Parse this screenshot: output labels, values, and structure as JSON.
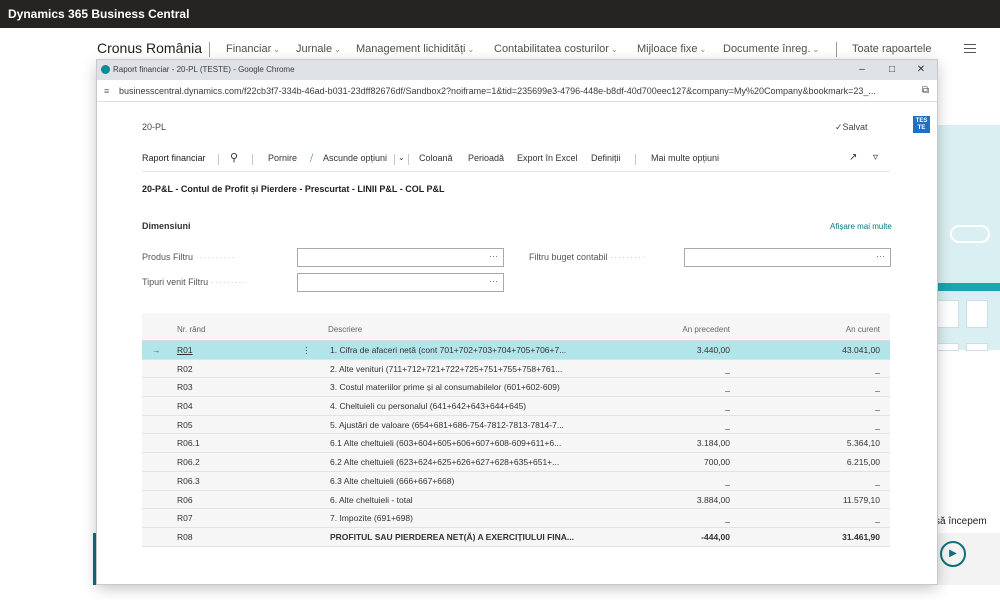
{
  "appbar": {
    "title": "Dynamics 365 Business Central"
  },
  "nav": {
    "company": "Cronus România",
    "items": [
      {
        "label": "Financiar",
        "chevron": true
      },
      {
        "label": "Jurnale",
        "chevron": true
      },
      {
        "label": "Management lichidități",
        "chevron": true
      },
      {
        "label": "Contabilitatea costurilor",
        "chevron": true
      },
      {
        "label": "Mijloace fixe",
        "chevron": true
      },
      {
        "label": "Documente înreg.",
        "chevron": true
      },
      {
        "label": "Toate rapoartele",
        "chevron": false
      }
    ]
  },
  "background": {
    "start_text": "să începem"
  },
  "browser": {
    "title": "Raport financiar - 20-PL (TESTE) - Google Chrome",
    "url": "businesscentral.dynamics.com/f22cb3f7-334b-46ad-b031-23dff82676df/Sandbox2?noiframe=1&tid=235699e3-4796-448e-b8df-40d700eec127&company=My%20Company&bookmark=23_..."
  },
  "page": {
    "record_id": "20-PL",
    "status": "Salvat",
    "test_badge": "TES TE",
    "report_title": "20-P&L - Contul de Profit și Pierdere - Prescurtat - LINII P&L - COL P&L"
  },
  "actions": {
    "main": "Raport financiar",
    "items": [
      "Pornire",
      "Ascunde opțiuni",
      "Coloană",
      "Perioadă",
      "Export în Excel",
      "Definiții",
      "Mai multe opțiuni"
    ]
  },
  "dimensions": {
    "title": "Dimensiuni",
    "show_more": "Afișare mai multe",
    "filters": [
      {
        "label": "Produs Filtru",
        "value": ""
      },
      {
        "label": "Tipuri venit Filtru",
        "value": ""
      },
      {
        "label": "Filtru buget contabil",
        "value": ""
      }
    ]
  },
  "table": {
    "headers": {
      "nr": "Nr. rând",
      "desc": "Descriere",
      "prev": "An precedent",
      "cur": "An curent"
    },
    "rows": [
      {
        "nr": "R01",
        "desc": "1. Cifra de afaceri netă (cont 701+702+703+704+705+706+7...",
        "prev": "3.440,00",
        "cur": "43.041,00",
        "selected": true,
        "bold": false
      },
      {
        "nr": "R02",
        "desc": "2. Alte venituri (711+712+721+722+725+751+755+758+761...",
        "prev": "_",
        "cur": "_",
        "selected": false,
        "bold": false
      },
      {
        "nr": "R03",
        "desc": "3. Costul materiilor prime și al consumabilelor (601+602-609)",
        "prev": "_",
        "cur": "_",
        "selected": false,
        "bold": false
      },
      {
        "nr": "R04",
        "desc": "4. Cheltuieli cu personalul (641+642+643+644+645)",
        "prev": "_",
        "cur": "_",
        "selected": false,
        "bold": false
      },
      {
        "nr": "R05",
        "desc": "5. Ajustări de valoare (654+681+686-754-7812-7813-7814-7...",
        "prev": "_",
        "cur": "_",
        "selected": false,
        "bold": false
      },
      {
        "nr": "R06.1",
        "desc": "6.1 Alte cheltuieli (603+604+605+606+607+608-609+611+6...",
        "prev": "3.184,00",
        "cur": "5.364,10",
        "selected": false,
        "bold": false
      },
      {
        "nr": "R06.2",
        "desc": "6.2 Alte cheltuieli (623+624+625+626+627+628+635+651+...",
        "prev": "700,00",
        "cur": "6.215,00",
        "selected": false,
        "bold": false
      },
      {
        "nr": "R06.3",
        "desc": "6.3 Alte cheltuieli (666+667+668)",
        "prev": "_",
        "cur": "_",
        "selected": false,
        "bold": false
      },
      {
        "nr": "R06",
        "desc": "6. Alte cheltuieli - total",
        "prev": "3.884,00",
        "cur": "11.579,10",
        "selected": false,
        "bold": false
      },
      {
        "nr": "R07",
        "desc": "7. Impozite (691+698)",
        "prev": "_",
        "cur": "_",
        "selected": false,
        "bold": false
      },
      {
        "nr": "R08",
        "desc": "PROFITUL SAU PIERDEREA NET(Ă) A EXERCIȚIULUI FINA...",
        "prev": "-444,00",
        "cur": "31.461,90",
        "selected": false,
        "bold": true
      }
    ]
  }
}
